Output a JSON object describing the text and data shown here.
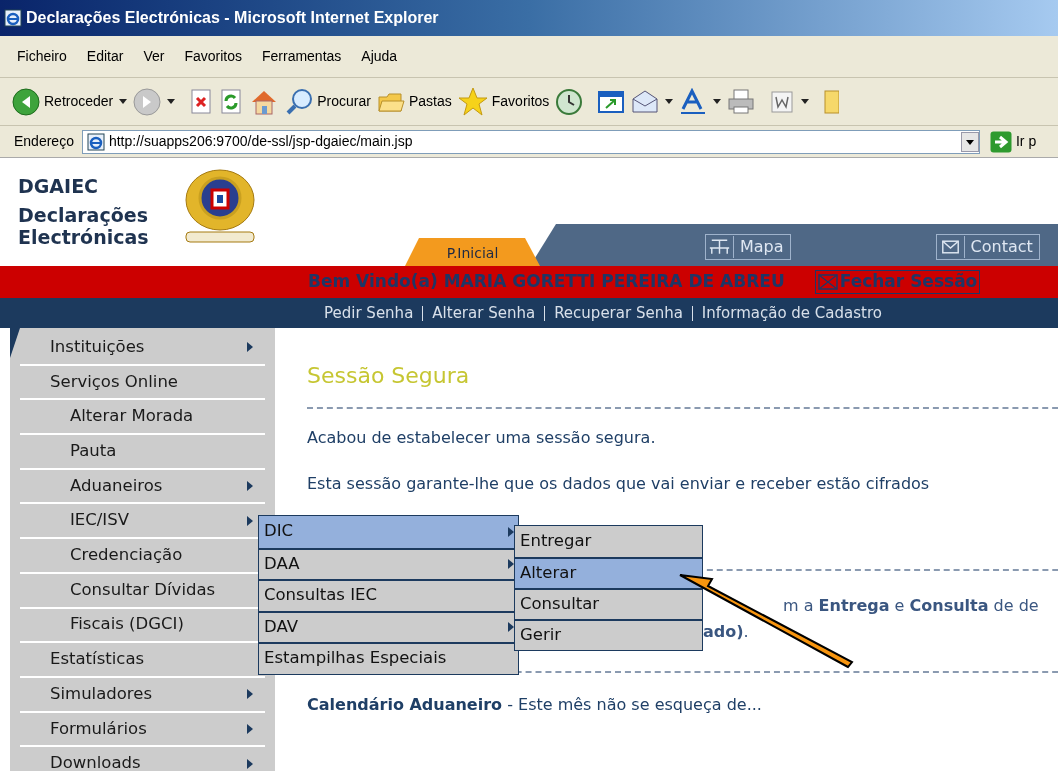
{
  "window": {
    "title": "Declarações Electrónicas - Microsoft Internet Explorer"
  },
  "menu_bar": [
    "Ficheiro",
    "Editar",
    "Ver",
    "Favoritos",
    "Ferramentas",
    "Ajuda"
  ],
  "toolbar": {
    "back_label": "Retroceder",
    "search_label": "Procurar",
    "folders_label": "Pastas",
    "favorites_label": "Favoritos"
  },
  "address_bar": {
    "label": "Endereço",
    "value": "http://suapps206:9700/de-ssl/jsp-dgaiec/main.jsp",
    "go_label": "Ir p"
  },
  "header": {
    "brand": "DGAIEC",
    "subtitle": "Declarações Electrónicas",
    "tabs": [
      {
        "label": "P.Inicial",
        "selected": true
      }
    ],
    "links": [
      "Mapa",
      "Contact"
    ]
  },
  "welcome": {
    "text": "Bem Vindo(a) MARIA GORETTI PEREIRA DE ABREU",
    "logout": "Fechar Sessão"
  },
  "account_links": [
    "Pedir Senha",
    "Alterar Senha",
    "Recuperar Senha",
    "Informação de Cadastro"
  ],
  "sidebar": {
    "items": [
      {
        "label": "Instituições",
        "has_submenu": true
      },
      {
        "label": "Serviços Online",
        "has_submenu": false,
        "children": [
          {
            "label": "Alterar Morada",
            "has_submenu": false
          },
          {
            "label": "Pauta",
            "has_submenu": false
          },
          {
            "label": "Aduaneiros",
            "has_submenu": true
          },
          {
            "label": "IEC/ISV",
            "has_submenu": true
          },
          {
            "label": "Credenciação",
            "has_submenu": false
          },
          {
            "label": "Consultar Dívidas",
            "has_submenu": false
          },
          {
            "label": "Fiscais (DGCI)",
            "has_submenu": false
          }
        ]
      },
      {
        "label": "Estatísticas",
        "has_submenu": false
      },
      {
        "label": "Simuladores",
        "has_submenu": true
      },
      {
        "label": "Formulários",
        "has_submenu": true
      },
      {
        "label": "Downloads",
        "has_submenu": true
      }
    ]
  },
  "flyout_menus": [
    {
      "items": [
        {
          "label": "DIC",
          "selected": true,
          "has_submenu": true
        },
        {
          "label": "DAA",
          "selected": false,
          "has_submenu": true
        },
        {
          "label": "Consultas IEC",
          "selected": false,
          "has_submenu": false
        },
        {
          "label": "DAV",
          "selected": false,
          "has_submenu": true
        },
        {
          "label": "Estampilhas Especiais",
          "selected": false,
          "has_submenu": false
        }
      ]
    },
    {
      "items": [
        {
          "label": "Entregar",
          "selected": false,
          "has_submenu": false
        },
        {
          "label": "Alterar",
          "selected": true,
          "has_submenu": false
        },
        {
          "label": "Consultar",
          "selected": false,
          "has_submenu": false
        },
        {
          "label": "Gerir",
          "selected": false,
          "has_submenu": false
        }
      ]
    }
  ],
  "content": {
    "title": "Sessão Segura",
    "paragraphs": [
      "Acabou de estabelecer uma sessão segura.",
      "Esta sessão garante-lhe que os dados que vai enviar e receber estão cifrados"
    ],
    "partial_lines": [
      "m a **Entrega** e **Consulta** de de",
      "**ado)**."
    ],
    "calendar": "**Calendário Aduaneiro** - Este mês não se esqueça de..."
  }
}
